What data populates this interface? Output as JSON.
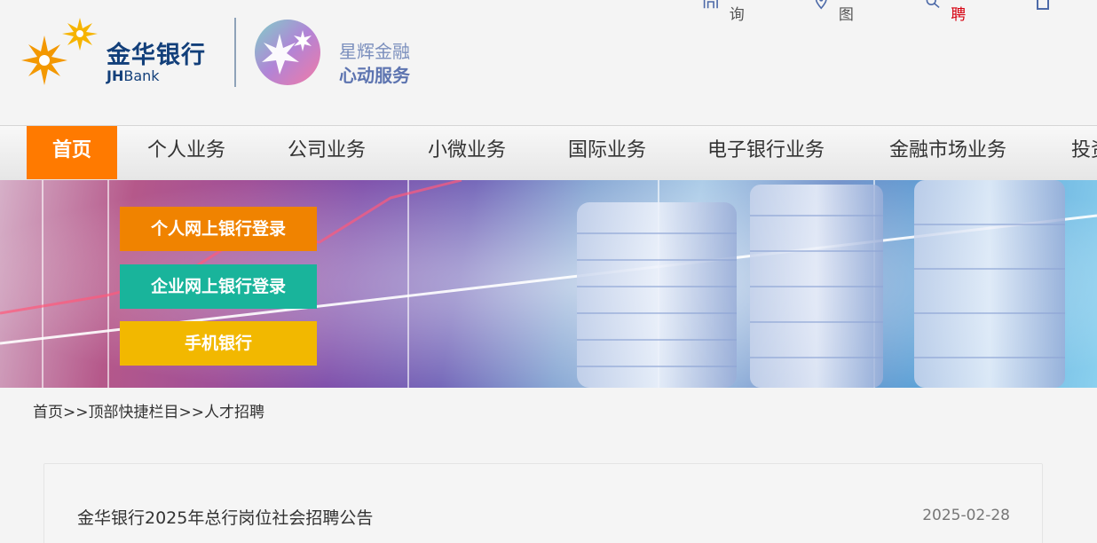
{
  "brand": {
    "name_cn": "金华银行",
    "name_en_bold": "JH",
    "name_en_light": "Bank",
    "slogan_line1": "星辉金融",
    "slogan_line2": "心动服务",
    "color_primary": "#123f7a",
    "color_accent": "#ff7a00"
  },
  "toplinks": [
    {
      "label": "网点查询",
      "icon": "building-icon"
    },
    {
      "label": "网站地图",
      "icon": "map-pin-icon"
    },
    {
      "label": "人才招聘",
      "icon": "search-icon",
      "color": "#d6000f"
    }
  ],
  "nav": {
    "items": [
      {
        "label": "首页",
        "active": true
      },
      {
        "label": "个人业务"
      },
      {
        "label": "公司业务"
      },
      {
        "label": "小微业务"
      },
      {
        "label": "国际业务"
      },
      {
        "label": "电子银行业务"
      },
      {
        "label": "金融市场业务"
      },
      {
        "label": "投资"
      }
    ]
  },
  "banner": {
    "personal_login": "个人网上银行登录",
    "corporate_login": "企业网上银行登录",
    "mobile_banking": "手机银行"
  },
  "breadcrumb": {
    "home": "首页",
    "sep1": ">>",
    "section": "顶部快捷栏目",
    "sep2": ">>",
    "current": "人才招聘"
  },
  "articles": [
    {
      "title": "金华银行2025年总行岗位社会招聘公告",
      "date": "2025-02-28"
    }
  ]
}
